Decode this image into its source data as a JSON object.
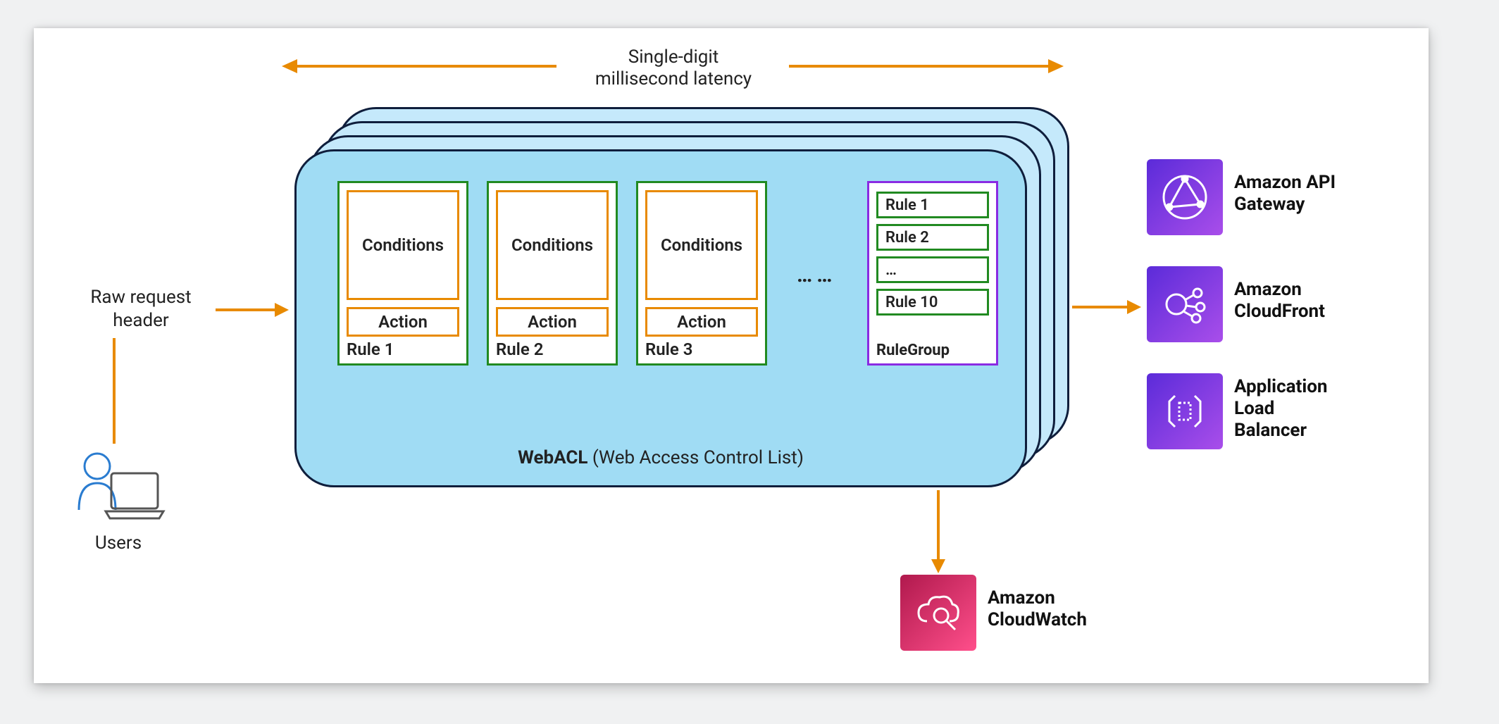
{
  "top": {
    "label_line1": "Single-digit",
    "label_line2": "millisecond latency"
  },
  "left": {
    "raw_line1": "Raw request",
    "raw_line2": "header",
    "users_label": "Users"
  },
  "webacl": {
    "caption_bold": "WebACL",
    "caption_rest": " (Web Access Control List)",
    "rules": [
      {
        "conditions": "Conditions",
        "action": "Action",
        "label": "Rule 1"
      },
      {
        "conditions": "Conditions",
        "action": "Action",
        "label": "Rule 2"
      },
      {
        "conditions": "Conditions",
        "action": "Action",
        "label": "Rule 3"
      }
    ],
    "ellipsis": "……",
    "rulegroup": {
      "items": [
        "Rule 1",
        "Rule 2",
        "…",
        "Rule 10"
      ],
      "label": "RuleGroup"
    }
  },
  "services": {
    "api_gateway": {
      "line1": "Amazon API",
      "line2": "Gateway"
    },
    "cloudfront": {
      "line1": "Amazon",
      "line2": "CloudFront"
    },
    "alb": {
      "line1": "Application",
      "line2": "Load",
      "line3": "Balancer"
    },
    "cloudwatch": {
      "line1": "Amazon",
      "line2": "CloudWatch"
    }
  },
  "colors": {
    "arrow": "#e88a00",
    "rule_border": "#218a21",
    "rulegroup_border": "#8a2be2",
    "card_border": "#0f1e3c",
    "card_bg": "#c5e9fb",
    "webacl_bg": "#a0dcf4"
  }
}
